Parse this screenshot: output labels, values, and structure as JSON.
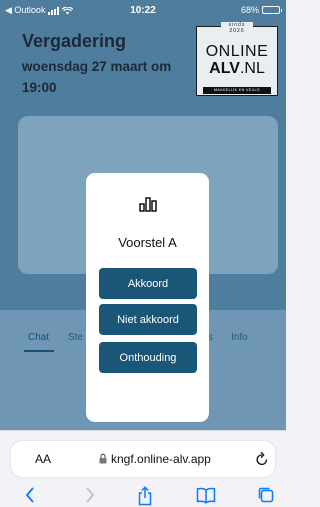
{
  "status_bar": {
    "back_app": "◀ Outlook",
    "time": "10:22",
    "battery": "68%",
    "battery_level": 0.68
  },
  "meeting": {
    "title": "Vergadering",
    "date": "woensdag 27 maart om 19:00"
  },
  "logo": {
    "sinds": "sinds 2020",
    "online": "ONLINE",
    "alv_bold": "ALV",
    "alv_suffix": ".NL",
    "tagline": "MAKKELIJK EN VEILIG"
  },
  "tabs": {
    "chat": "Chat",
    "stemmen_partial": "Ste",
    "partial_right": "s",
    "info": "Info"
  },
  "modal": {
    "icon": "poll-icon",
    "title": "Voorstel A",
    "options": [
      "Akkoord",
      "Niet akkoord",
      "Onthouding"
    ]
  },
  "safari": {
    "aa": "AA",
    "url": "kngf.online-alv.app"
  },
  "colors": {
    "accent": "#1a5678",
    "overlay_bg": "#4f7d9d",
    "toolbar_blue": "#0a7aff"
  }
}
